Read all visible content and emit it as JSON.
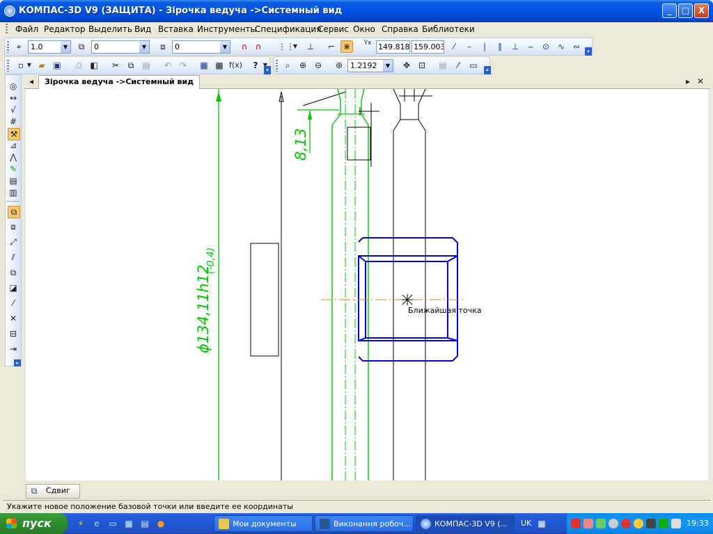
{
  "window": {
    "title": "КОМПАС-3D V9 (ЗАЩИТА) - Зірочка ведуча ->Системный вид",
    "buttons": {
      "minimize": "_",
      "maximize": "□",
      "close": "X"
    }
  },
  "menu": {
    "items": [
      "Файл",
      "Редактор",
      "Выделить",
      "Вид",
      "Вставка",
      "Инструменты",
      "Спецификация",
      "Сервис",
      "Окно",
      "Справка",
      "Библиотеки"
    ]
  },
  "toolbar": {
    "line_scale": "1.0",
    "current_layer": "0",
    "style_value": "0",
    "coord_x": "149.818",
    "coord_y": "159.003",
    "zoom": "1.2192"
  },
  "document": {
    "tab_label": "Зірочка ведуча ->Системный вид"
  },
  "drawing": {
    "dim_vertical": "8,13",
    "dim_diameter": "ϕ134,11h12",
    "dim_tolerance": "(-0,4)",
    "snap_hint": "Ближайшая точка"
  },
  "bottom_panel": {
    "tab_label": "Сдвиг"
  },
  "statusbar": {
    "message": "Укажите новое положение базовой точки или введите ее координаты"
  },
  "taskbar": {
    "start_label": "пуск",
    "tasks": [
      "Мои документы",
      "Виконання робоч...",
      "КОМПАС-3D V9 (..."
    ],
    "language": "UK",
    "clock": "19:33"
  },
  "colors": {
    "title_blue": "#0054e3",
    "drawing_green": "#00c800",
    "contour_blue": "#0000e6",
    "axis_orange": "#c98a1a",
    "start_green": "#3c9e3c"
  }
}
